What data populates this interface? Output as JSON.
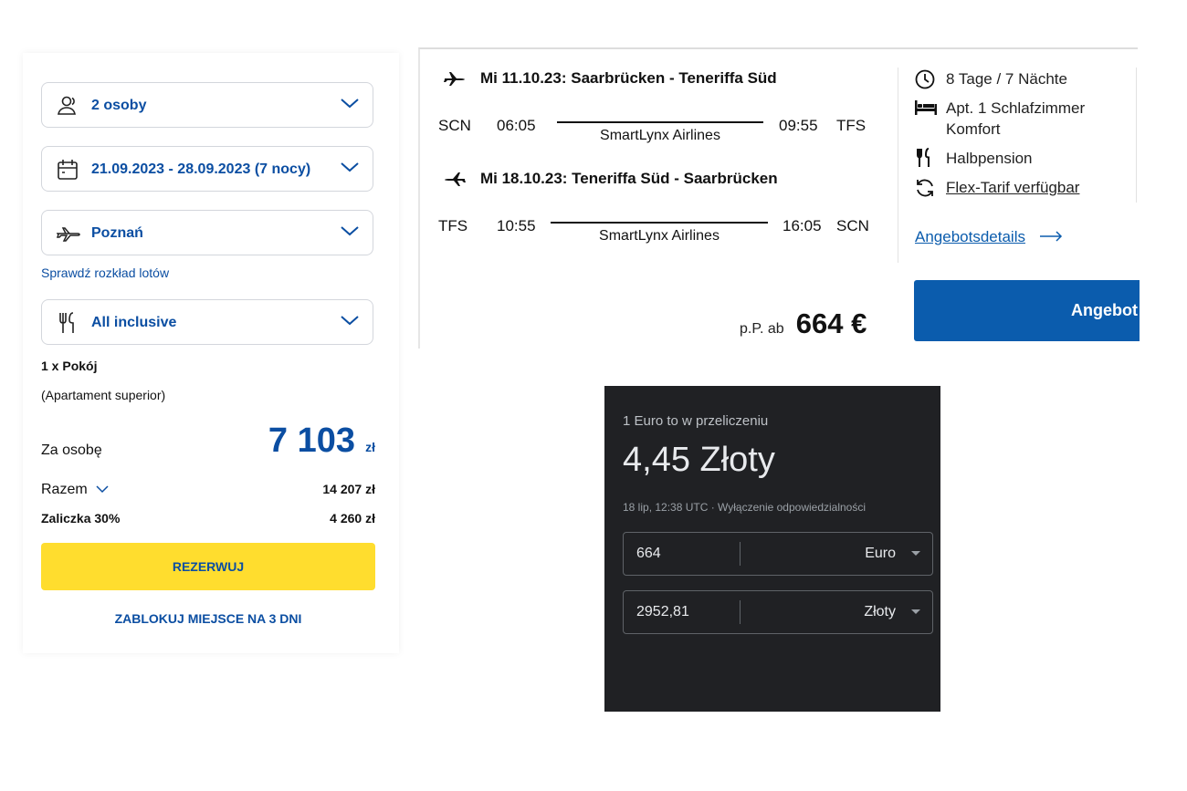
{
  "booking": {
    "travelers": {
      "label": "2 osoby",
      "icon": "user-icon"
    },
    "dates": {
      "label": "21.09.2023 - 28.09.2023 (7 nocy)",
      "icon": "calendar-icon"
    },
    "departure": {
      "label": "Poznań",
      "icon": "airplane-icon"
    },
    "schedule_link": "Sprawdź rozkład lotów",
    "board": {
      "label": "All inclusive",
      "icon": "cutlery-icon"
    },
    "room_count": "1 x Pokój",
    "room_type": "(Apartament superior)",
    "per_person_label": "Za osobę",
    "per_person_price": "7 103",
    "per_person_currency": "zł",
    "total_label": "Razem",
    "total_value": "14 207 zł",
    "deposit_label": "Zaliczka 30%",
    "deposit_value": "4 260 zł",
    "book_button": "REZERWUJ",
    "hold_button": "ZABLOKUJ MIEJSCE NA 3 DNI",
    "colors": {
      "accent": "#0b4ea2",
      "button": "#ffdd2e"
    }
  },
  "flights": {
    "outbound": {
      "title": "Mi 11.10.23: Saarbrücken - Teneriffa Süd",
      "from_code": "SCN",
      "dep_time": "06:05",
      "airline": "SmartLynx Airlines",
      "arr_time": "09:55",
      "to_code": "TFS"
    },
    "return": {
      "title": "Mi 18.10.23: Teneriffa Süd - Saarbrücken",
      "from_code": "TFS",
      "dep_time": "10:55",
      "airline": "SmartLynx Airlines",
      "arr_time": "16:05",
      "to_code": "SCN"
    },
    "details": {
      "duration": "8 Tage / 7 Nächte",
      "room_line1": "Apt. 1 Schlafzimmer",
      "room_line2": "Komfort",
      "board": "Halbpension",
      "flex": "Flex-Tarif verfügbar",
      "offer_details_link": "Angebotsdetails"
    },
    "price_prefix": "p.P. ab",
    "price": "664 €",
    "offer_button": "Angebot",
    "colors": {
      "button": "#0b5cad"
    }
  },
  "converter": {
    "heading": "1 Euro to w przeliczeniu",
    "rate": "4,45 Złoty",
    "timestamp": "18 lip, 12:38 UTC · Wyłączenie odpowiedzialności",
    "from_value": "664",
    "from_unit": "Euro",
    "to_value": "2952,81",
    "to_unit": "Złoty"
  }
}
